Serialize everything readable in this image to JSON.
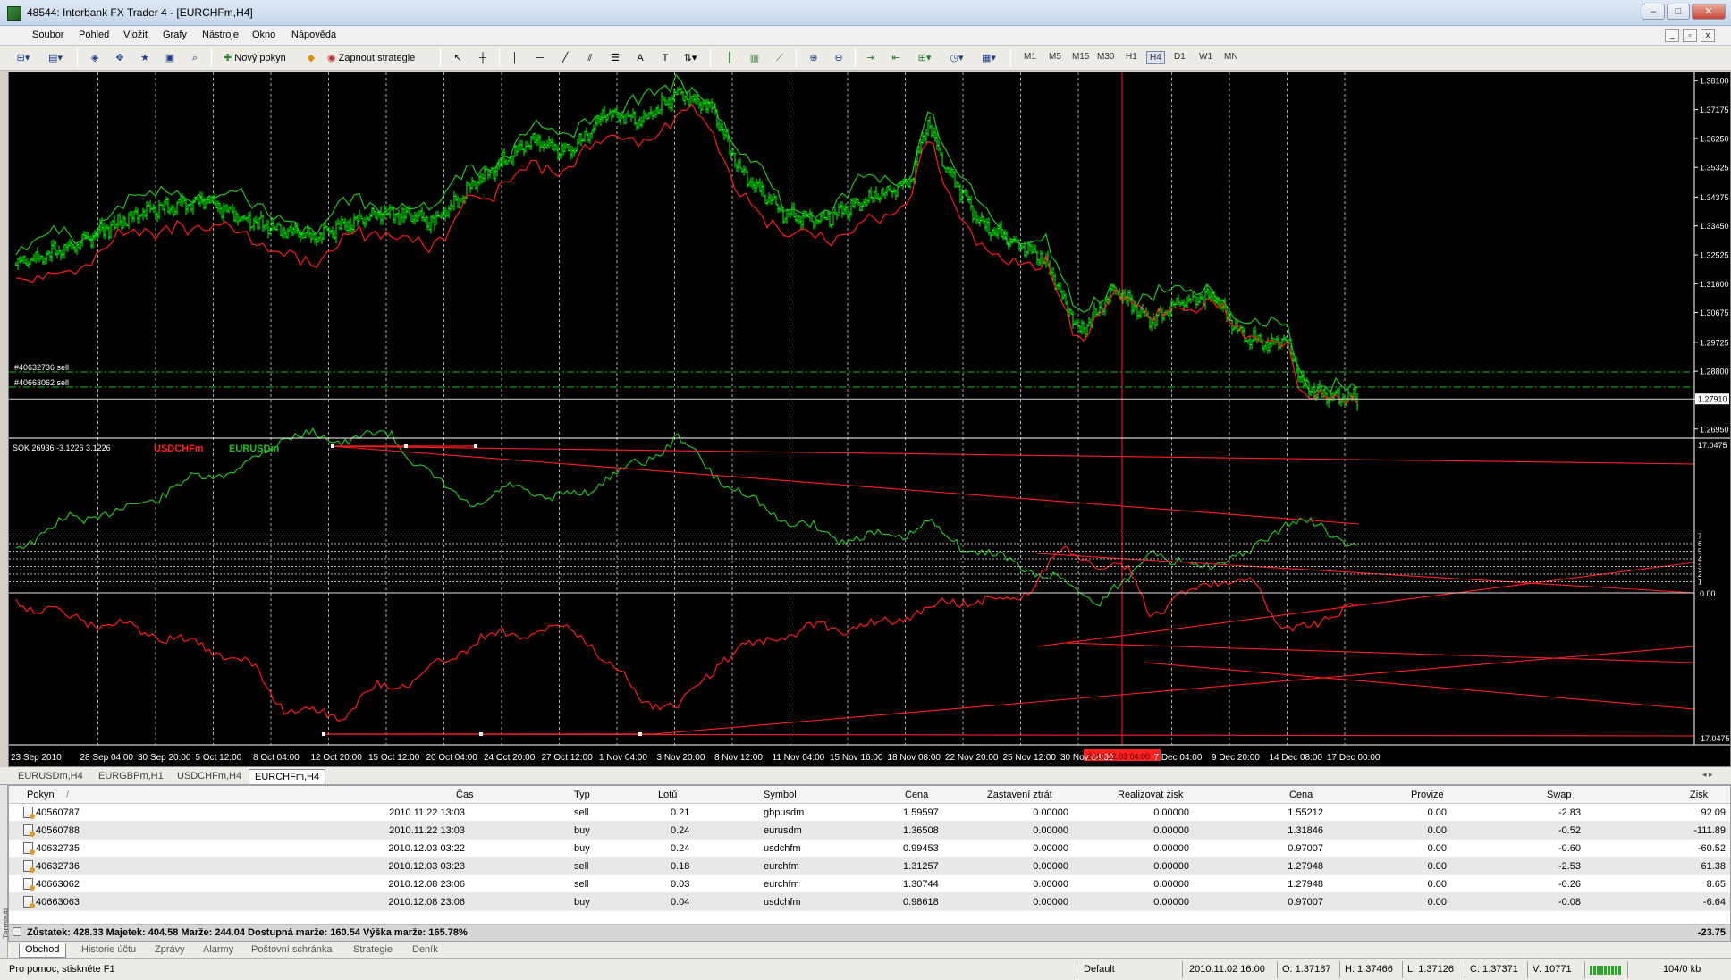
{
  "window": {
    "title": "48544: Interbank FX Trader 4 - [EURCHFm,H4]"
  },
  "menu": [
    "Soubor",
    "Pohled",
    "Vložit",
    "Grafy",
    "Nástroje",
    "Okno",
    "Nápověda"
  ],
  "toolbar": {
    "new_order": "Nový pokyn",
    "strategies": "Zapnout strategie",
    "timeframes": [
      "M1",
      "M5",
      "M15",
      "M30",
      "H1",
      "H4",
      "D1",
      "W1",
      "MN"
    ],
    "active_timeframe": "H4"
  },
  "chart": {
    "symbol": "EURCHFm,H4",
    "price_labels": [
      "1.38100",
      "1.37175",
      "1.36250",
      "1.35325",
      "1.34375",
      "1.33450",
      "1.32525",
      "1.31600",
      "1.30675",
      "1.29725",
      "1.28800",
      "1.27910",
      "1.26950"
    ],
    "current_price": "1.27910",
    "order_lines": [
      "#40632736 sell",
      "#40663062 sell"
    ],
    "indicator": {
      "label": "SOK 26936 -3.1226 3.1226",
      "series": [
        {
          "name": "USDCHFm",
          "color": "#ff2020"
        },
        {
          "name": "EURUSDm",
          "color": "#20c020"
        }
      ],
      "scale_top": "17.0475",
      "scale_bottom": "-17.0475",
      "scale_zero": "0.00",
      "levels": [
        "7",
        "6",
        "5",
        "4",
        "3",
        "2",
        "1"
      ]
    },
    "time_labels": [
      "23 Sep 2010",
      "28 Sep 04:00",
      "30 Sep 20:00",
      "5 Oct 12:00",
      "8 Oct 04:00",
      "12 Oct 20:00",
      "15 Oct 12:00",
      "20 Oct 04:00",
      "24 Oct 20:00",
      "27 Oct 12:00",
      "1 Nov 04:00",
      "3 Nov 20:00",
      "8 Nov 12:00",
      "11 Nov 04:00",
      "15 Nov 16:00",
      "18 Nov 08:00",
      "22 Nov 20:00",
      "25 Nov 12:00",
      "30 Nov 04:00",
      "7 Dec 04:00",
      "9 Dec 20:00",
      "14 Dec 08:00",
      "17 Dec 00:00"
    ],
    "crosshair_time": "2010.12.03 04:00",
    "colors": {
      "bars": "#00ff00",
      "red_line": "#ff1a1a",
      "green_line": "#22c022",
      "grid": "#c8c8c8"
    }
  },
  "chart_tabs": [
    "EURUSDm,H4",
    "EURGBPm,H1",
    "USDCHFm,H4",
    "EURCHFm,H4"
  ],
  "chart_tabs_active": "EURCHFm,H4",
  "terminal": {
    "columns": [
      "Pokyn",
      "Čas",
      "Typ",
      "Lotů",
      "Symbol",
      "Cena",
      "Zastavení ztrát",
      "Realizovat zisk",
      "Cena",
      "Provize",
      "Swap",
      "Zisk"
    ],
    "rows": [
      [
        "40560787",
        "2010.11.22 13:03",
        "sell",
        "0.21",
        "gbpusdm",
        "1.59597",
        "0.00000",
        "0.00000",
        "1.55212",
        "0.00",
        "-2.83",
        "92.09"
      ],
      [
        "40560788",
        "2010.11.22 13:03",
        "buy",
        "0.24",
        "eurusdm",
        "1.36508",
        "0.00000",
        "0.00000",
        "1.31846",
        "0.00",
        "-0.52",
        "-111.89"
      ],
      [
        "40632735",
        "2010.12.03 03:22",
        "buy",
        "0.24",
        "usdchfm",
        "0.99453",
        "0.00000",
        "0.00000",
        "0.97007",
        "0.00",
        "-0.60",
        "-60.52"
      ],
      [
        "40632736",
        "2010.12.03 03:23",
        "sell",
        "0.18",
        "eurchfm",
        "1.31257",
        "0.00000",
        "0.00000",
        "1.27948",
        "0.00",
        "-2.53",
        "61.38"
      ],
      [
        "40663062",
        "2010.12.08 23:06",
        "sell",
        "0.03",
        "eurchfm",
        "1.30744",
        "0.00000",
        "0.00000",
        "1.27948",
        "0.00",
        "-0.26",
        "8.65"
      ],
      [
        "40663063",
        "2010.12.08 23:06",
        "buy",
        "0.04",
        "usdchfm",
        "0.98618",
        "0.00000",
        "0.00000",
        "0.97007",
        "0.00",
        "-0.08",
        "-6.64"
      ]
    ],
    "summary": "Zůstatek: 428.33  Majetek: 404.58  Marže: 244.04  Dostupná marže: 160.54  Výška marže: 165.78%",
    "summary_total": "-23.75",
    "side_label": "Terminál"
  },
  "bottom_tabs": [
    "Obchod",
    "Historie účtu",
    "Zprávy",
    "Alarmy",
    "Poštovní schránka",
    "Strategie",
    "Deník"
  ],
  "bottom_tabs_active": "Obchod",
  "status": {
    "help": "Pro pomoc, stiskněte F1",
    "profile": "Default",
    "time": "2010.11.02 16:00",
    "open": "O: 1.37187",
    "high": "H: 1.37466",
    "low": "L: 1.37126",
    "close": "C: 1.37371",
    "volume": "V: 10771",
    "traffic": "104/0 kb"
  }
}
